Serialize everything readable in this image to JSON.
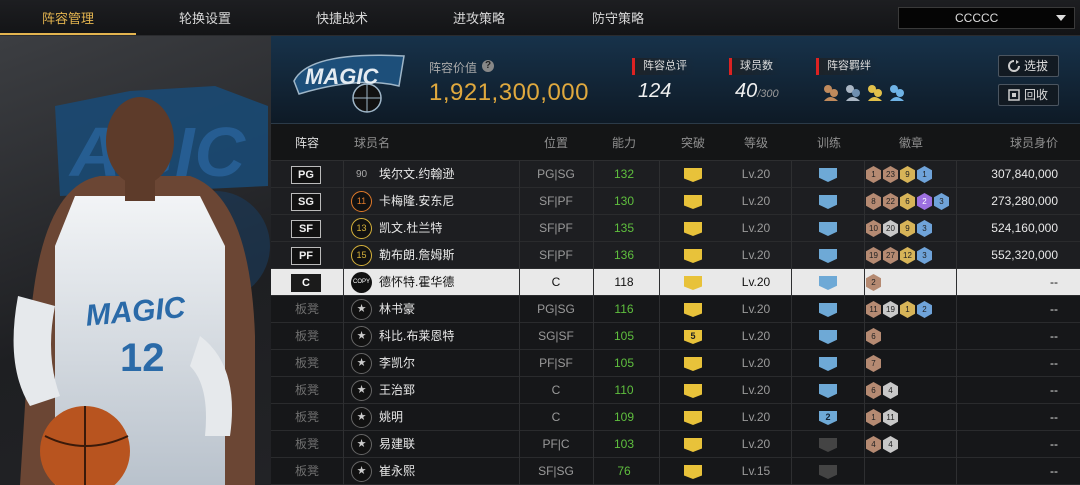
{
  "nav": {
    "tabs": [
      "阵容管理",
      "轮换设置",
      "快捷战术",
      "进攻策略",
      "防守策略"
    ],
    "active_index": 0,
    "team_select": "CCCCC"
  },
  "header": {
    "team_logo_text": "MAGIC",
    "lineup_value_label": "阵容价值",
    "lineup_value": "1,921,300,000",
    "overall_label": "阵容总评",
    "overall_value": "124",
    "player_count_label": "球员数",
    "player_count": "40",
    "player_count_max": "/300",
    "bond_label": "阵容羁绊",
    "select_button": "选拔",
    "recycle_button": "回收"
  },
  "columns": [
    "阵容",
    "球员名",
    "位置",
    "能力",
    "突破",
    "等级",
    "训练",
    "徽章",
    "球员身价"
  ],
  "rows": [
    {
      "slot": "PG",
      "type": "starter",
      "number": "90",
      "number_style": "plain",
      "name": "埃尔文.约翰逊",
      "position": "PG|SG",
      "ability": "132",
      "breakthrough": "",
      "level": "Lv.20",
      "training": "",
      "badges": [
        {
          "v": "1",
          "c": "bronze"
        },
        {
          "v": "23",
          "c": "bronze"
        },
        {
          "v": "9",
          "c": "gold"
        },
        {
          "v": "1",
          "c": "blue"
        }
      ],
      "value": "307,840,000"
    },
    {
      "slot": "SG",
      "type": "starter",
      "number": "11",
      "number_style": "orange",
      "name": "卡梅隆.安东尼",
      "position": "SF|PF",
      "ability": "130",
      "breakthrough": "",
      "level": "Lv.20",
      "training": "",
      "badges": [
        {
          "v": "8",
          "c": "bronze"
        },
        {
          "v": "22",
          "c": "bronze"
        },
        {
          "v": "6",
          "c": "gold"
        },
        {
          "v": "2",
          "c": "purple"
        },
        {
          "v": "3",
          "c": "blue"
        }
      ],
      "value": "273,280,000"
    },
    {
      "slot": "SF",
      "type": "starter",
      "number": "13",
      "number_style": "yellow",
      "name": "凯文.杜兰特",
      "position": "SF|PF",
      "ability": "135",
      "breakthrough": "",
      "level": "Lv.20",
      "training": "",
      "badges": [
        {
          "v": "10",
          "c": "bronze"
        },
        {
          "v": "20",
          "c": "silver"
        },
        {
          "v": "9",
          "c": "gold"
        },
        {
          "v": "3",
          "c": "blue"
        }
      ],
      "value": "524,160,000"
    },
    {
      "slot": "PF",
      "type": "starter",
      "number": "15",
      "number_style": "yellow",
      "name": "勒布朗.詹姆斯",
      "position": "SF|PF",
      "ability": "136",
      "breakthrough": "",
      "level": "Lv.20",
      "training": "",
      "badges": [
        {
          "v": "19",
          "c": "bronze"
        },
        {
          "v": "27",
          "c": "bronze"
        },
        {
          "v": "12",
          "c": "gold"
        },
        {
          "v": "3",
          "c": "blue"
        }
      ],
      "value": "552,320,000"
    },
    {
      "slot": "C",
      "type": "selected",
      "number": "COPY",
      "number_style": "plain",
      "name": "德怀特.霍华德",
      "position": "C",
      "ability": "118",
      "breakthrough": "",
      "level": "Lv.20",
      "training": "",
      "badges": [
        {
          "v": "2",
          "c": "bronze"
        }
      ],
      "value": "--"
    },
    {
      "slot": "板凳",
      "type": "bench",
      "number": "★",
      "number_style": "star",
      "name": "林书豪",
      "position": "PG|SG",
      "ability": "116",
      "breakthrough": "",
      "level": "Lv.20",
      "training": "",
      "badges": [
        {
          "v": "11",
          "c": "bronze"
        },
        {
          "v": "19",
          "c": "silver"
        },
        {
          "v": "1",
          "c": "gold"
        },
        {
          "v": "2",
          "c": "blue"
        }
      ],
      "value": "--"
    },
    {
      "slot": "板凳",
      "type": "bench",
      "number": "★",
      "number_style": "star",
      "name": "科比.布莱恩特",
      "position": "SG|SF",
      "ability": "105",
      "breakthrough": "5",
      "level": "Lv.20",
      "training": "",
      "badges": [
        {
          "v": "6",
          "c": "bronze"
        }
      ],
      "value": "--"
    },
    {
      "slot": "板凳",
      "type": "bench",
      "number": "★",
      "number_style": "star",
      "name": "李凯尔",
      "position": "PF|SF",
      "ability": "105",
      "breakthrough": "",
      "level": "Lv.20",
      "training": "",
      "badges": [
        {
          "v": "7",
          "c": "bronze"
        }
      ],
      "value": "--"
    },
    {
      "slot": "板凳",
      "type": "bench",
      "number": "★",
      "number_style": "star",
      "name": "王治郅",
      "position": "C",
      "ability": "110",
      "breakthrough": "",
      "level": "Lv.20",
      "training": "",
      "badges": [
        {
          "v": "6",
          "c": "bronze"
        },
        {
          "v": "4",
          "c": "silver"
        }
      ],
      "value": "--"
    },
    {
      "slot": "板凳",
      "type": "bench",
      "number": "★",
      "number_style": "star",
      "name": "姚明",
      "position": "C",
      "ability": "109",
      "breakthrough": "",
      "level": "Lv.20",
      "training": "2",
      "badges": [
        {
          "v": "1",
          "c": "bronze"
        },
        {
          "v": "11",
          "c": "silver"
        }
      ],
      "value": "--"
    },
    {
      "slot": "板凳",
      "type": "bench",
      "number": "★",
      "number_style": "star",
      "name": "易建联",
      "position": "PF|C",
      "ability": "103",
      "breakthrough": "",
      "level": "Lv.20",
      "training": "dark",
      "badges": [
        {
          "v": "4",
          "c": "bronze"
        },
        {
          "v": "4",
          "c": "silver"
        }
      ],
      "value": "--"
    },
    {
      "slot": "板凳",
      "type": "bench",
      "number": "★",
      "number_style": "star",
      "name": "崔永熙",
      "position": "SF|SG",
      "ability": "76",
      "breakthrough": "",
      "level": "Lv.15",
      "training": "dark",
      "badges": [],
      "value": "--"
    }
  ],
  "colors": {
    "accent": "#e3b44f",
    "ability_green": "#5fbf3e",
    "value_gold": "#e0a93e"
  }
}
